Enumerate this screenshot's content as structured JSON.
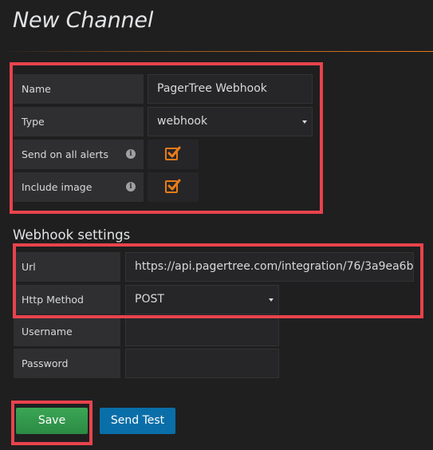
{
  "page": {
    "title": "New Channel"
  },
  "channel": {
    "name_label": "Name",
    "name_value": "PagerTree Webhook",
    "type_label": "Type",
    "type_value": "webhook",
    "send_all_label": "Send on all alerts",
    "send_all_checked": true,
    "include_image_label": "Include image",
    "include_image_checked": true
  },
  "webhook": {
    "section_title": "Webhook settings",
    "url_label": "Url",
    "url_value": "https://api.pagertree.com/integration/76/3a9ea6b...",
    "method_label": "Http Method",
    "method_value": "POST",
    "username_label": "Username",
    "username_value": "",
    "password_label": "Password",
    "password_value": ""
  },
  "actions": {
    "save_label": "Save",
    "send_test_label": "Send Test"
  },
  "colors": {
    "accent": "#eb7b18",
    "highlight": "#e8434d",
    "save": "#2f9a4b",
    "send_test": "#0a6fa8"
  },
  "icons": {
    "info": "info-icon",
    "checkbox": "checkbox-checked-icon",
    "dropdown": "caret-down-icon"
  }
}
